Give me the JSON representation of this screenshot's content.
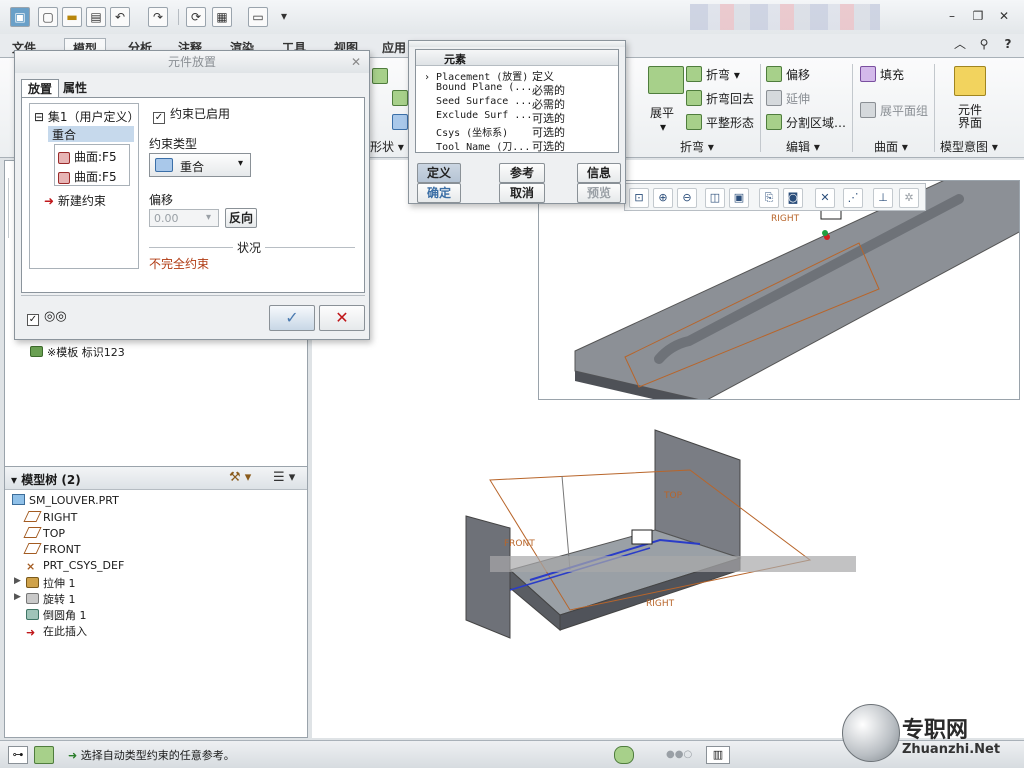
{
  "tabs": [
    "文件",
    "模型",
    "分析",
    "注释",
    "渲染",
    "工具",
    "视图",
    "应用"
  ],
  "ribbon": {
    "tools": {
      "flatten": "展平",
      "bend": "折弯",
      "bend_back": "折弯回去",
      "flat_form": "平整形态",
      "offset": "偏移",
      "extend": "延伸",
      "split_area": "分割区域…",
      "fill": "填充",
      "flat_pattern_group": "展平面组",
      "component_interface": "元件界面",
      "shape_partial": "形状"
    },
    "groups": [
      "折弯",
      "编辑",
      "曲面",
      "模型意图"
    ]
  },
  "component_dialog": {
    "title": "元件放置",
    "tabs": [
      "放置",
      "属性"
    ],
    "tree": {
      "set": "集1（用户定义）",
      "constraint": "重合",
      "refs": [
        "曲面:F5",
        "曲面:F5"
      ],
      "new": "新建约束"
    },
    "enabled_label": "约束已启用",
    "type_label": "约束类型",
    "type_value": "重合",
    "offset_label": "偏移",
    "offset_value": "0.00",
    "flip_button": "反向",
    "status_label": "状况",
    "status_value": "不完全约束"
  },
  "element_dialog": {
    "header": "元素",
    "rows": [
      {
        "name": "Placement (放置)",
        "status": "定义"
      },
      {
        "name": "Bound Plane (...",
        "status": "必需的"
      },
      {
        "name": "Seed Surface ...",
        "status": "必需的"
      },
      {
        "name": "Exclude Surf ...",
        "status": "可选的"
      },
      {
        "name": "Csys (坐标系)",
        "status": "可选的"
      },
      {
        "name": "Tool Name (刀...",
        "status": "可选的"
      }
    ],
    "buttons": [
      "定义",
      "参考",
      "信息",
      "确定",
      "取消",
      "预览"
    ]
  },
  "left_panel": {
    "template_item": "※模板 标识123",
    "model_tree_title": "模型树 (2)",
    "items": [
      "SM_LOUVER.PRT",
      "RIGHT",
      "TOP",
      "FRONT",
      "PRT_CSYS_DEF",
      "拉伸 1",
      "旋转 1",
      "倒圆角 1",
      "在此插入"
    ]
  },
  "viewport_labels": {
    "right": "RIGHT",
    "top": "TOP",
    "front": "FRONT",
    "right2": "RIGHT"
  },
  "status": {
    "message": "选择自动类型约束的任意参考。"
  },
  "watermark": {
    "text": "专职网",
    "site": "Zhuanzhi.Net"
  }
}
